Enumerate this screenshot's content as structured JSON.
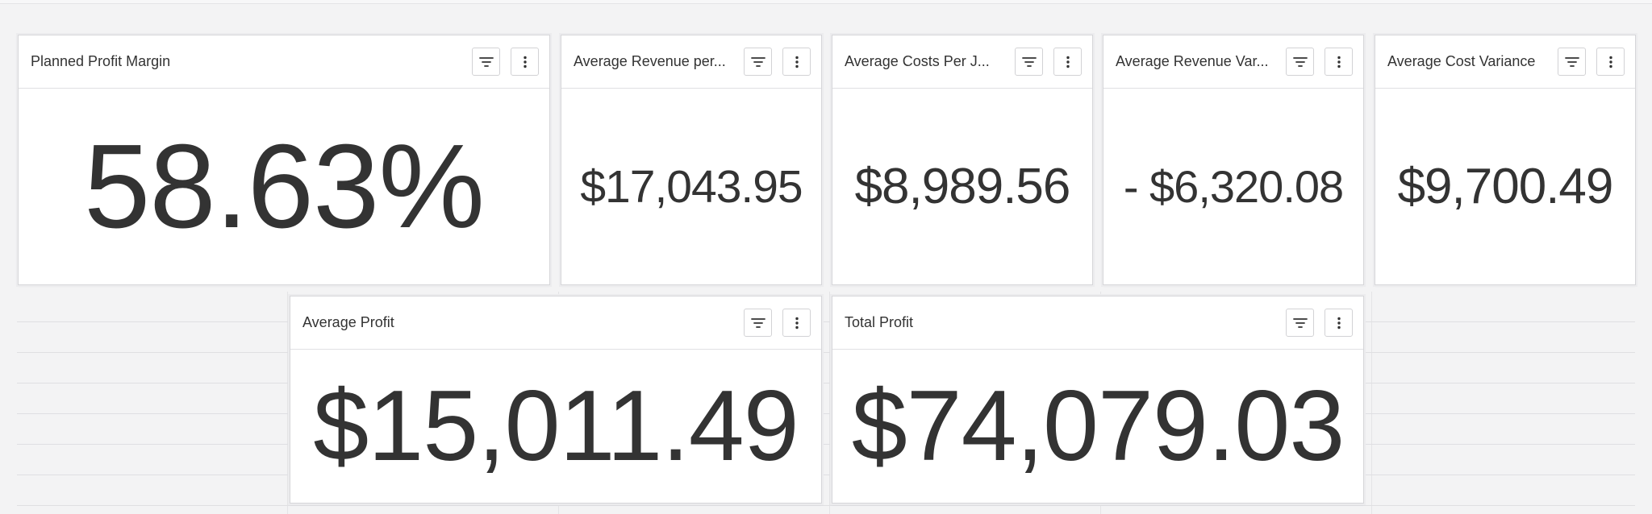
{
  "dashboard": {
    "cards": [
      {
        "title": "Planned Profit Margin",
        "value": "58.63%"
      },
      {
        "title": "Average Revenue per...",
        "value": "$17,043.95"
      },
      {
        "title": "Average Costs Per J...",
        "value": "$8,989.56"
      },
      {
        "title": "Average Revenue Var...",
        "value": "- $6,320.08"
      },
      {
        "title": "Average Cost Variance",
        "value": "$9,700.49"
      },
      {
        "title": "Average Profit",
        "value": "$15,011.49"
      },
      {
        "title": "Total Profit",
        "value": "$74,079.03"
      }
    ],
    "icons": {
      "filter": "filter-icon",
      "more": "more-vertical-icon"
    }
  }
}
